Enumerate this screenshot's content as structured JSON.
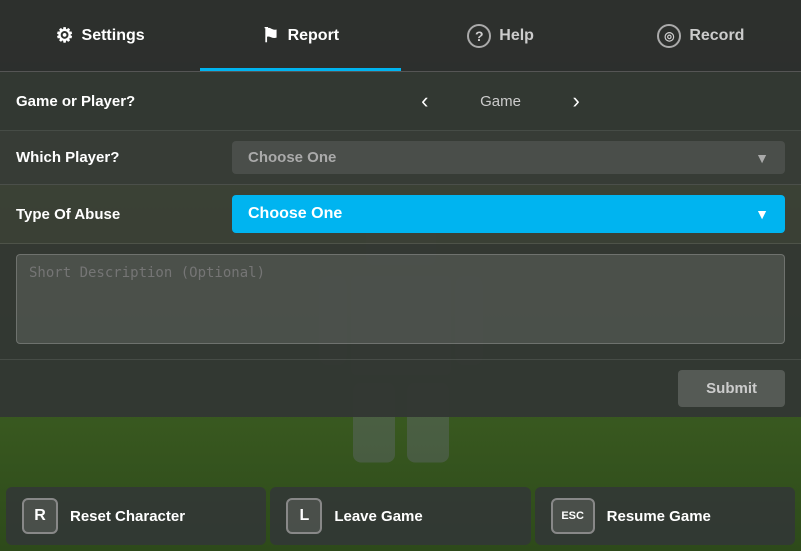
{
  "nav": {
    "items": [
      {
        "id": "settings",
        "label": "Settings",
        "icon": "⚙",
        "active": false
      },
      {
        "id": "report",
        "label": "Report",
        "icon": "⚑",
        "active": true
      },
      {
        "id": "help",
        "label": "Help",
        "icon": "?",
        "active": false
      },
      {
        "id": "record",
        "label": "Record",
        "icon": "◎",
        "active": false
      }
    ]
  },
  "report": {
    "game_player_label": "Game or Player?",
    "game_player_value": "Game",
    "which_player_label": "Which Player?",
    "which_player_placeholder": "Choose One",
    "abuse_type_label": "Type Of Abuse",
    "abuse_type_placeholder": "Choose One",
    "description_placeholder": "Short Description (Optional)",
    "submit_label": "Submit"
  },
  "bottom": {
    "reset": {
      "key": "R",
      "label": "Reset Character"
    },
    "leave": {
      "key": "L",
      "label": "Leave Game"
    },
    "resume": {
      "key": "ESC",
      "label": "Resume Game"
    }
  }
}
